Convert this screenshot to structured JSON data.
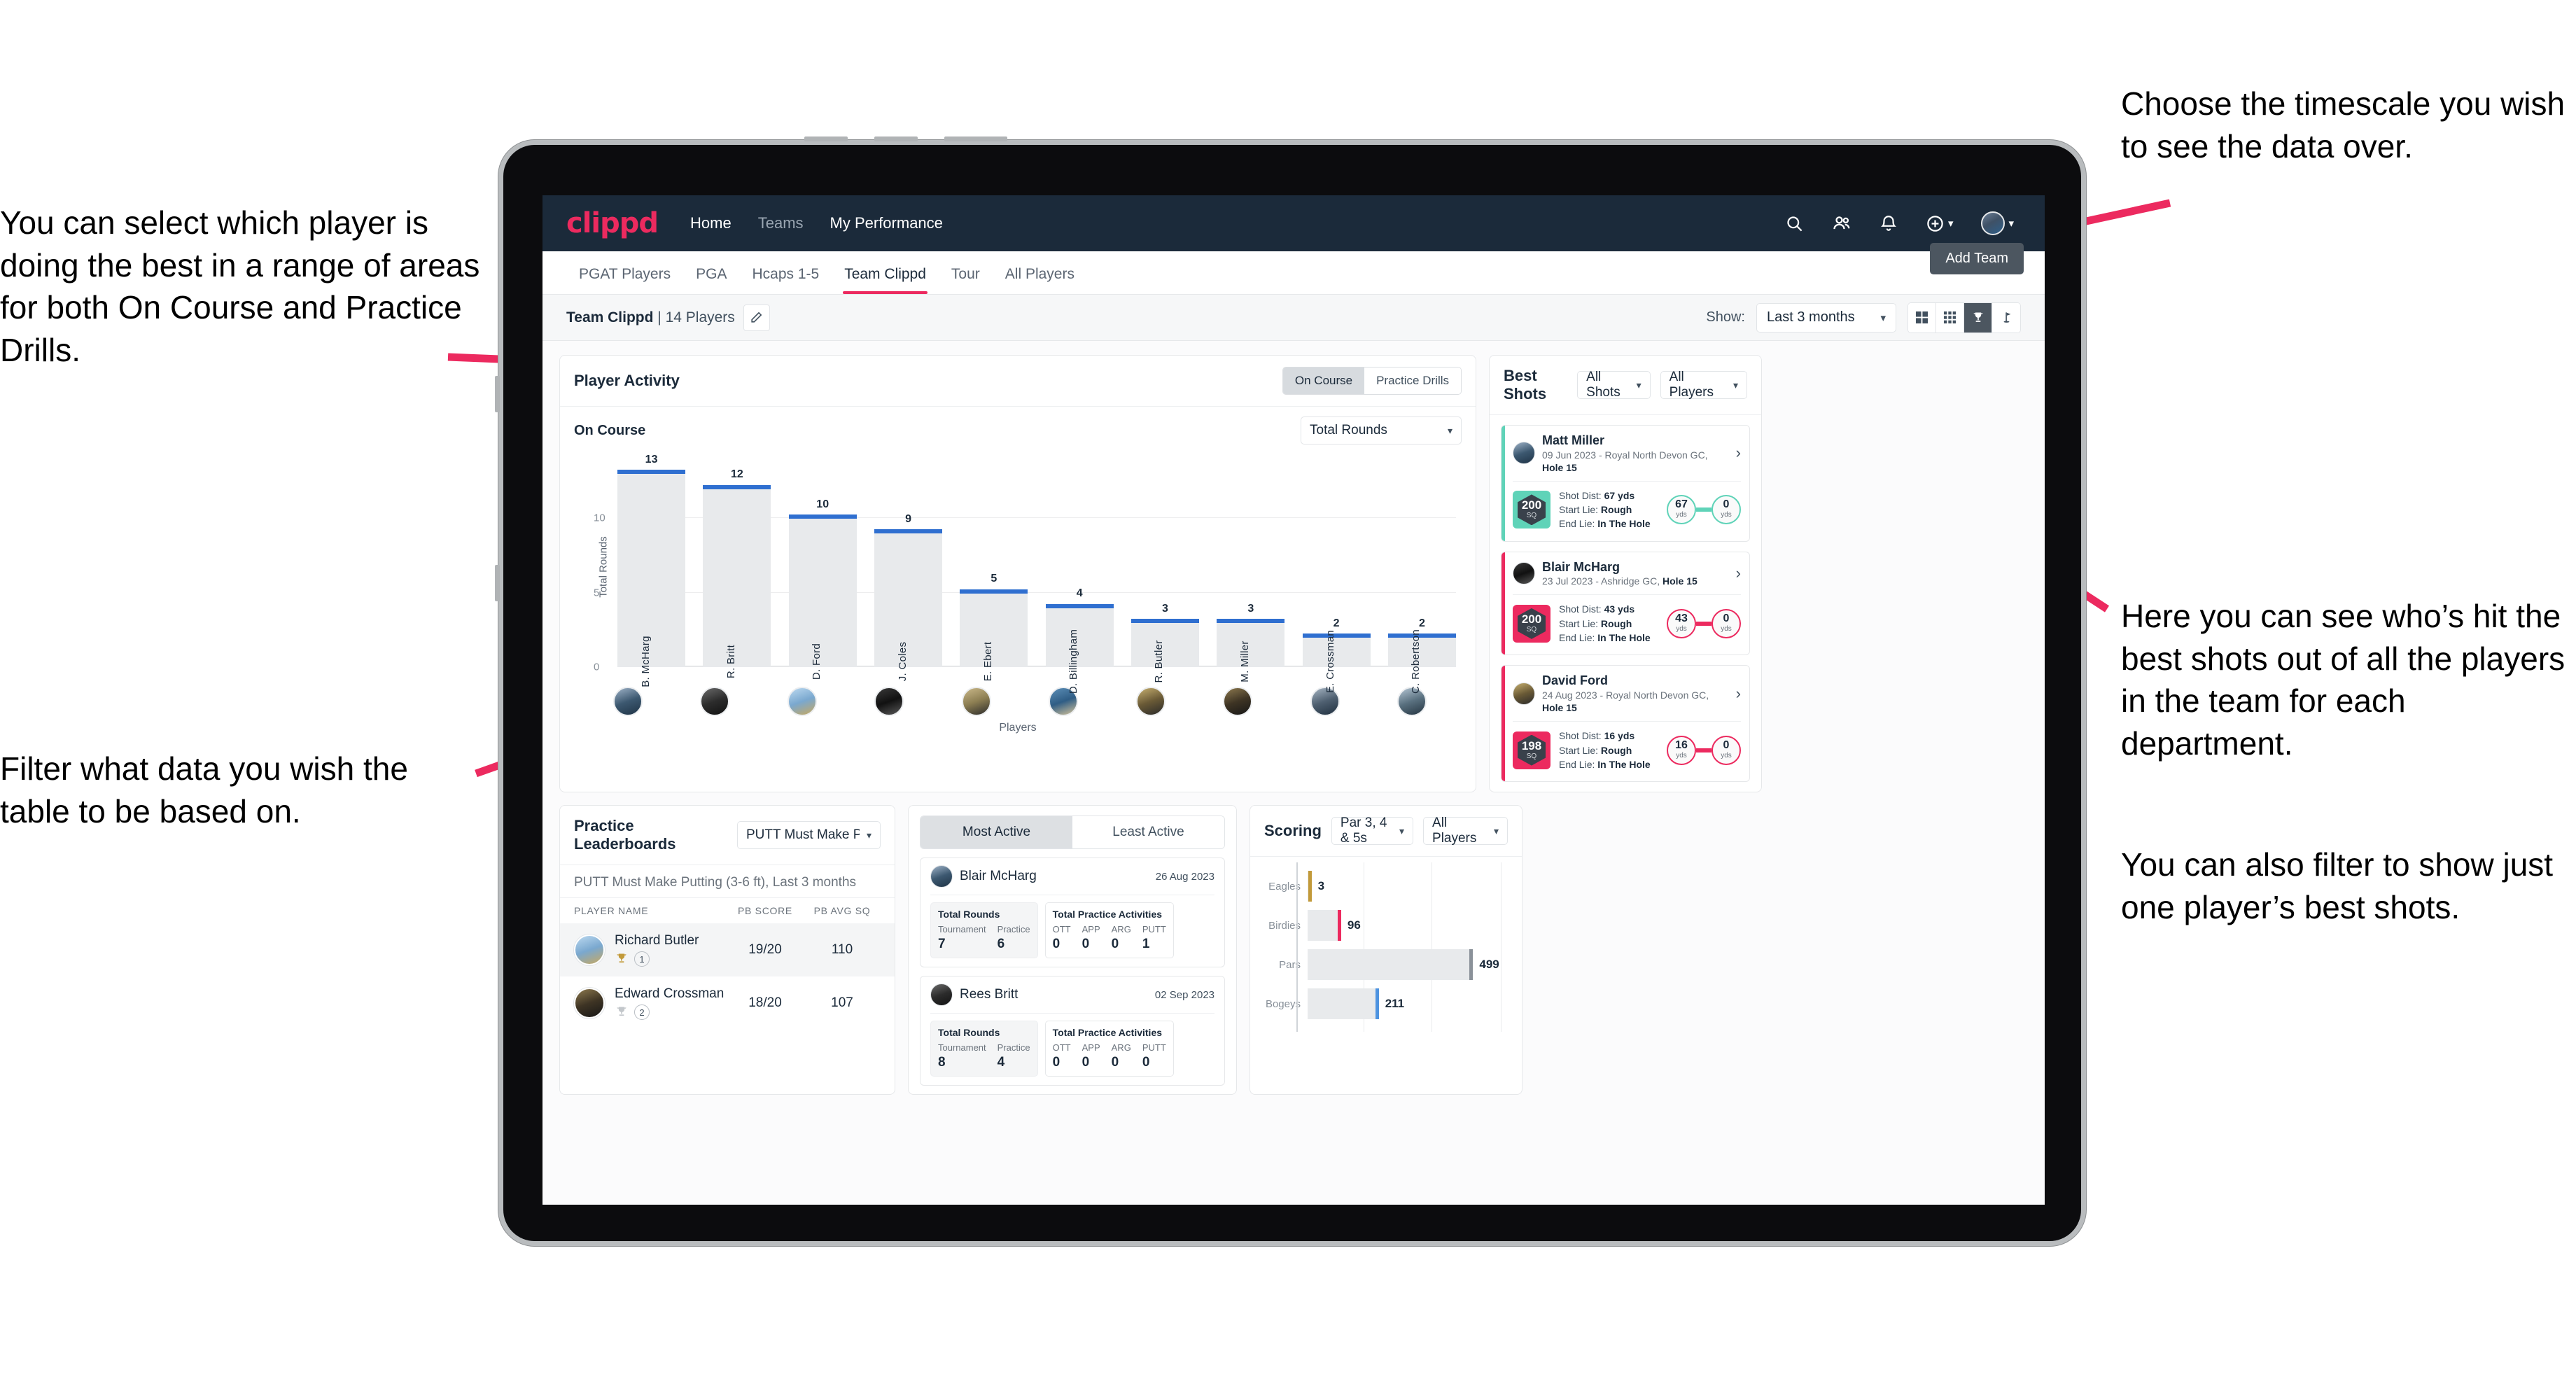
{
  "annotations": {
    "top_left": "You can select which player is doing the best in a range of areas for both On Course and Practice Drills.",
    "bottom_left": "Filter what data you wish the table to be based on.",
    "top_right": "Choose the timescale you wish to see the data over.",
    "middle_right": "Here you can see who’s hit the best shots out of all the players in the team for each department.",
    "bottom_right": "You can also filter to show just one player’s best shots."
  },
  "colors": {
    "brand_pink": "#ec2a5f",
    "nav_dark": "#1b2a3a",
    "bar_blue": "#2f6fd0",
    "teal": "#5fd3b8",
    "gold": "#c29a3a"
  },
  "topnav": {
    "logo": "clippd",
    "links": [
      {
        "label": "Home",
        "active": true
      },
      {
        "label": "Teams",
        "active": false
      },
      {
        "label": "My Performance",
        "active": false
      }
    ],
    "icons": [
      "search-icon",
      "people-icon",
      "bell-icon",
      "plus-circle-icon",
      "avatar"
    ]
  },
  "tabs": [
    {
      "label": "PGAT Players",
      "active": false
    },
    {
      "label": "PGA",
      "active": false
    },
    {
      "label": "Hcaps 1-5",
      "active": false
    },
    {
      "label": "Team Clippd",
      "active": true
    },
    {
      "label": "Tour",
      "active": false
    },
    {
      "label": "All Players",
      "active": false
    }
  ],
  "add_team_button": "Add Team",
  "toolbar": {
    "team_name": "Team Clippd",
    "team_count": "| 14 Players",
    "show_label": "Show:",
    "timescale_value": "Last 3 months",
    "view_icons": [
      {
        "name": "grid-4-icon",
        "active": false
      },
      {
        "name": "grid-9-icon",
        "active": false
      },
      {
        "name": "trophy-icon",
        "active": true
      },
      {
        "name": "flag-icon",
        "active": false
      }
    ]
  },
  "player_activity": {
    "title": "Player Activity",
    "segments": [
      {
        "label": "On Course",
        "active": true
      },
      {
        "label": "Practice Drills",
        "active": false
      }
    ],
    "sub_label": "On Course",
    "metric_value": "Total Rounds",
    "x_axis_label": "Players"
  },
  "chart_data": [
    {
      "type": "bar",
      "title": "Player Activity — On Course",
      "xlabel": "Players",
      "ylabel": "Total Rounds",
      "ylim": [
        0,
        14
      ],
      "yticks": [
        0,
        5,
        10
      ],
      "grid": true,
      "categories": [
        "B. McHarg",
        "R. Britt",
        "D. Ford",
        "J. Coles",
        "E. Ebert",
        "D. Billingham",
        "R. Butler",
        "M. Miller",
        "E. Crossman",
        "C. Robertson"
      ],
      "values": [
        13,
        12,
        10,
        9,
        5,
        4,
        3,
        3,
        2,
        2
      ]
    },
    {
      "type": "bar",
      "title": "Scoring — Par 3, 4 & 5s",
      "orientation": "horizontal",
      "categories": [
        "Eagles",
        "Birdies",
        "Pars",
        "Bogeys"
      ],
      "values": [
        3,
        96,
        499,
        211
      ],
      "xlim": [
        0,
        620
      ],
      "grid": true,
      "cap_colors": [
        "#c29a3a",
        "#ec2a5f",
        "#8a9199",
        "#4d93e0"
      ]
    }
  ],
  "best_shots": {
    "title": "Best Shots",
    "filter_shots": "All Shots",
    "filter_players": "All Players",
    "cards": [
      {
        "player": "Matt Miller",
        "meta_date": "09 Jun 2023 - Royal North Devon GC,",
        "meta_hole": "Hole 15",
        "sq": "200",
        "sq_unit": "SQ",
        "tile_color": "#5fd3b8",
        "shot_dist_label": "Shot Dist:",
        "shot_dist": "67 yds",
        "start_lie_label": "Start Lie:",
        "start_lie": "Rough",
        "end_lie_label": "End Lie:",
        "end_lie": "In The Hole",
        "from_val": "67",
        "from_unit": "yds",
        "to_val": "0",
        "to_unit": "yds"
      },
      {
        "player": "Blair McHarg",
        "meta_date": "23 Jul 2023 - Ashridge GC,",
        "meta_hole": "Hole 15",
        "sq": "200",
        "sq_unit": "SQ",
        "tile_color": "#ec2a5f",
        "shot_dist_label": "Shot Dist:",
        "shot_dist": "43 yds",
        "start_lie_label": "Start Lie:",
        "start_lie": "Rough",
        "end_lie_label": "End Lie:",
        "end_lie": "In The Hole",
        "from_val": "43",
        "from_unit": "yds",
        "to_val": "0",
        "to_unit": "yds"
      },
      {
        "player": "David Ford",
        "meta_date": "24 Aug 2023 - Royal North Devon GC,",
        "meta_hole": "Hole 15",
        "sq": "198",
        "sq_unit": "SQ",
        "tile_color": "#ec2a5f",
        "shot_dist_label": "Shot Dist:",
        "shot_dist": "16 yds",
        "start_lie_label": "Start Lie:",
        "start_lie": "Rough",
        "end_lie_label": "End Lie:",
        "end_lie": "In The Hole",
        "from_val": "16",
        "from_unit": "yds",
        "to_val": "0",
        "to_unit": "yds"
      }
    ]
  },
  "practice_leaderboards": {
    "title": "Practice Leaderboards",
    "drill_select": "PUTT Must Make Putting ...",
    "subtitle_bold": "PUTT Must Make Putting (3-6 ft),",
    "subtitle_light": "Last 3 months",
    "columns": [
      "PLAYER NAME",
      "PB SCORE",
      "PB AVG SQ"
    ],
    "rows": [
      {
        "name": "Richard Butler",
        "rank": "1",
        "medal": "gold",
        "pb_score": "19/20",
        "pb_avg_sq": "110"
      },
      {
        "name": "Edward Crossman",
        "rank": "2",
        "medal": "silver",
        "pb_score": "18/20",
        "pb_avg_sq": "107"
      }
    ]
  },
  "activity": {
    "tabs": [
      {
        "label": "Most Active",
        "active": true
      },
      {
        "label": "Least Active",
        "active": false
      }
    ],
    "cards": [
      {
        "player": "Blair McHarg",
        "date": "26 Aug 2023",
        "rounds_title": "Total Rounds",
        "rounds": [
          {
            "key": "Tournament",
            "val": "7"
          },
          {
            "key": "Practice",
            "val": "6"
          }
        ],
        "practice_title": "Total Practice Activities",
        "practice": [
          {
            "key": "OTT",
            "val": "0"
          },
          {
            "key": "APP",
            "val": "0"
          },
          {
            "key": "ARG",
            "val": "0"
          },
          {
            "key": "PUTT",
            "val": "1"
          }
        ]
      },
      {
        "player": "Rees Britt",
        "date": "02 Sep 2023",
        "rounds_title": "Total Rounds",
        "rounds": [
          {
            "key": "Tournament",
            "val": "8"
          },
          {
            "key": "Practice",
            "val": "4"
          }
        ],
        "practice_title": "Total Practice Activities",
        "practice": [
          {
            "key": "OTT",
            "val": "0"
          },
          {
            "key": "APP",
            "val": "0"
          },
          {
            "key": "ARG",
            "val": "0"
          },
          {
            "key": "PUTT",
            "val": "0"
          }
        ]
      }
    ]
  },
  "scoring": {
    "title": "Scoring",
    "filter_par": "Par 3, 4 & 5s",
    "filter_players": "All Players"
  }
}
